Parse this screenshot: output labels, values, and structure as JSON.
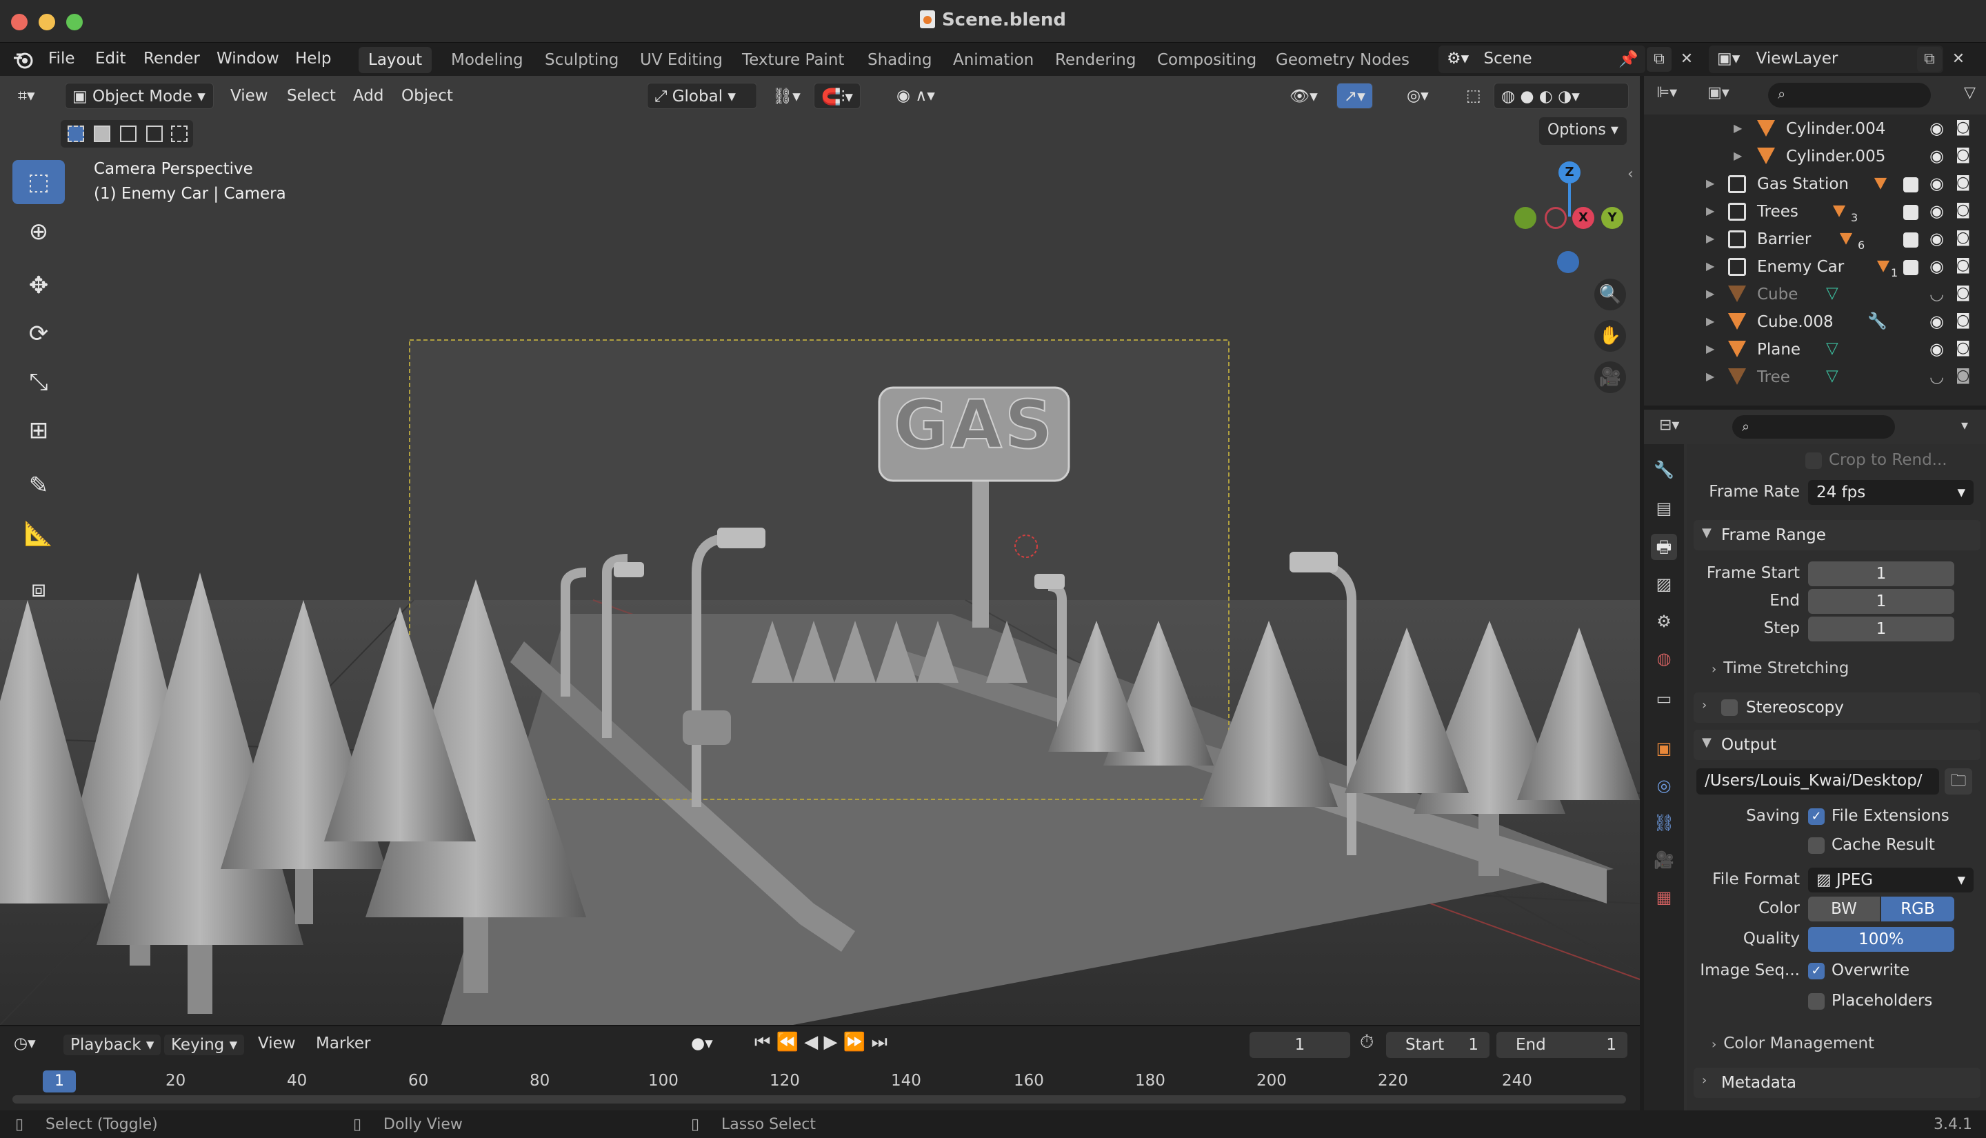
{
  "window": {
    "title": "Scene.blend",
    "version": "3.4.1"
  },
  "menu": [
    "File",
    "Edit",
    "Render",
    "Window",
    "Help"
  ],
  "workspaces": [
    {
      "label": "Layout",
      "active": true
    },
    {
      "label": "Modeling"
    },
    {
      "label": "Sculpting"
    },
    {
      "label": "UV Editing"
    },
    {
      "label": "Texture Paint"
    },
    {
      "label": "Shading"
    },
    {
      "label": "Animation"
    },
    {
      "label": "Rendering"
    },
    {
      "label": "Compositing"
    },
    {
      "label": "Geometry Nodes"
    }
  ],
  "scene": {
    "name": "Scene",
    "view_layer": "ViewLayer"
  },
  "viewport": {
    "mode": "Object Mode",
    "menus": [
      "View",
      "Select",
      "Add",
      "Object"
    ],
    "transform_orientation": "Global",
    "options_label": "Options",
    "overlay_text_1": "Camera Perspective",
    "overlay_text_2": "(1) Enemy Car | Camera",
    "sign_text": "GAS",
    "gizmo": {
      "z": "Z",
      "x": "X",
      "y": "Y"
    }
  },
  "outliner": {
    "rows": [
      {
        "name": "Cylinder.004",
        "type": "mesh",
        "dim": false
      },
      {
        "name": "Cylinder.005",
        "type": "mesh",
        "dim": false
      },
      {
        "name": "Gas Station",
        "type": "collection",
        "dim": false,
        "badge": ""
      },
      {
        "name": "Trees",
        "type": "collection",
        "dim": false,
        "badge": "3"
      },
      {
        "name": "Barrier",
        "type": "collection",
        "dim": false,
        "badge": "6"
      },
      {
        "name": "Enemy Car",
        "type": "collection",
        "dim": false,
        "badge": "1"
      },
      {
        "name": "Cube",
        "type": "mesh",
        "dim": true
      },
      {
        "name": "Cube.008",
        "type": "mesh",
        "dim": false
      },
      {
        "name": "Plane",
        "type": "mesh",
        "dim": false
      },
      {
        "name": "Tree",
        "type": "mesh",
        "dim": true
      }
    ]
  },
  "properties": {
    "crop_label": "Crop to Rend...",
    "frame_rate_label": "Frame Rate",
    "frame_rate": "24 fps",
    "frame_range": {
      "title": "Frame Range",
      "start_label": "Frame Start",
      "start": "1",
      "end_label": "End",
      "end": "1",
      "step_label": "Step",
      "step": "1"
    },
    "time_stretching": "Time Stretching",
    "stereoscopy": "Stereoscopy",
    "output": {
      "title": "Output",
      "path": "/Users/Louis_Kwai/Desktop/",
      "saving_label": "Saving",
      "file_extensions": "File Extensions",
      "cache_result": "Cache Result",
      "file_format_label": "File Format",
      "file_format": "JPEG",
      "color_label": "Color",
      "color_bw": "BW",
      "color_rgb": "RGB",
      "quality_label": "Quality",
      "quality": "100%",
      "image_seq_label": "Image Seq...",
      "overwrite": "Overwrite",
      "placeholders": "Placeholders"
    },
    "color_management": "Color Management",
    "metadata": "Metadata"
  },
  "timeline": {
    "menus": [
      "Playback",
      "Keying",
      "View",
      "Marker"
    ],
    "current_frame": "1",
    "start_label": "Start",
    "start": "1",
    "end_label": "End",
    "end": "1",
    "ticks": [
      "20",
      "40",
      "60",
      "80",
      "100",
      "120",
      "140",
      "160",
      "180",
      "200",
      "220",
      "240"
    ],
    "cursor": "1"
  },
  "status": {
    "select": "Select (Toggle)",
    "dolly": "Dolly View",
    "lasso": "Lasso Select"
  },
  "colors": {
    "accent": "#4772b3",
    "orange": "#e8883a",
    "gizmo_x": "#e0425a",
    "gizmo_y": "#88b032",
    "gizmo_z": "#3d8de0"
  }
}
